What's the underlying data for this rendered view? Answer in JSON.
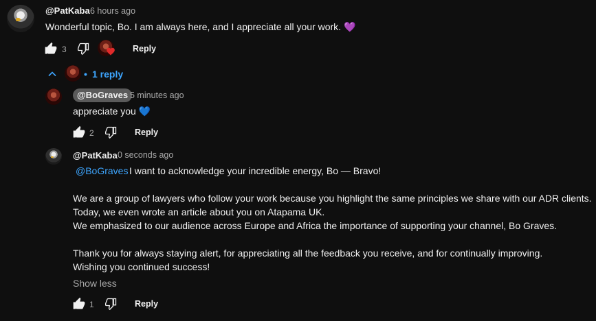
{
  "comment": {
    "author": "@PatKaba",
    "time": "6 hours ago",
    "text": "Wonderful topic, Bo. I am always here, and I appreciate all your work. 💜",
    "likes": "3",
    "reply_label": "Reply"
  },
  "replies_toggle": {
    "separator": "•",
    "label": "1 reply"
  },
  "reply1": {
    "author": "@BoGraves",
    "time": "5 minutes ago",
    "text": "appreciate you 💙",
    "likes": "2",
    "reply_label": "Reply"
  },
  "reply2": {
    "author": "@PatKaba",
    "time": "0 seconds ago",
    "mention": "@BoGraves",
    "line1": "I want to acknowledge your incredible energy, Bo — Bravo!",
    "line2": "We are a group of lawyers who follow your work because you highlight the same principles we share with our ADR clients.",
    "line3": "Today, we even wrote an article about you on Atapama UK.",
    "line4": "We emphasized to our audience across Europe and Africa the importance of supporting your channel, Bo Graves.",
    "line5": "Thank you for always staying alert, for appreciating all the feedback you receive, and for continually improving.",
    "line6": "Wishing you continued success!",
    "show_less": "Show less",
    "likes": "1",
    "reply_label": "Reply"
  },
  "icons": {
    "like": "thumbs-up-icon",
    "dislike": "thumbs-down-icon",
    "creator_heart": "creator-heart-icon",
    "collapse": "chevron-up-icon"
  },
  "colors": {
    "background": "#0f0f0f",
    "link": "#3ea6ff",
    "secondary_text": "#aaaaaa",
    "heart": "#e02a2a"
  }
}
